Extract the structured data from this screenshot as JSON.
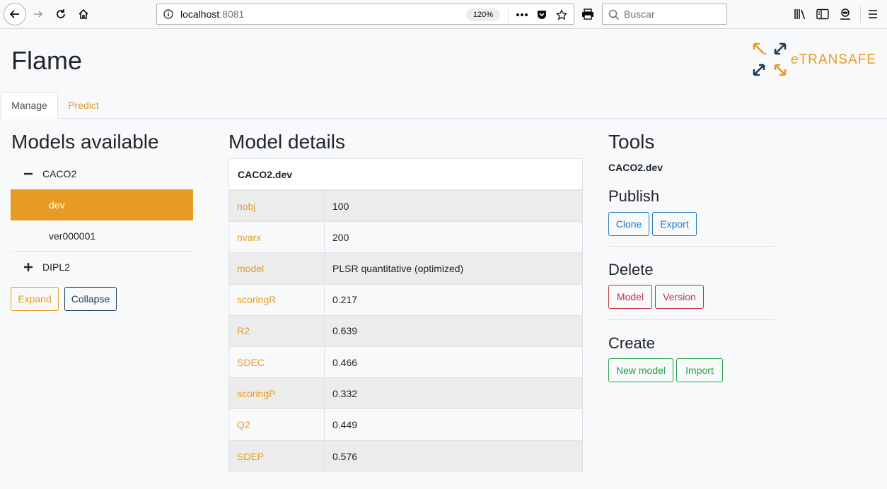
{
  "browser": {
    "url_host": "localhost",
    "url_port": ":8081",
    "zoom": "120%",
    "search_placeholder": "Buscar"
  },
  "app": {
    "title": "Flame",
    "logo_e": "e",
    "logo_text": "TRANSAFE"
  },
  "tabs": [
    {
      "label": "Manage",
      "active": true
    },
    {
      "label": "Predict",
      "active": false
    }
  ],
  "models_panel": {
    "heading": "Models available",
    "tree": [
      {
        "label": "CACO2",
        "expanded": true,
        "children": [
          {
            "label": "dev",
            "selected": true
          },
          {
            "label": "ver000001",
            "selected": false
          }
        ]
      },
      {
        "label": "DIPL2",
        "expanded": false
      }
    ],
    "expand_label": "Expand",
    "collapse_label": "Collapse"
  },
  "details_panel": {
    "heading": "Model details",
    "model_name": "CACO2.dev",
    "rows": [
      {
        "key": "nobj",
        "value": "100"
      },
      {
        "key": "nvarx",
        "value": "200"
      },
      {
        "key": "model",
        "value": "PLSR quantitative (optimized)"
      },
      {
        "key": "scoringR",
        "value": "0.217"
      },
      {
        "key": "R2",
        "value": "0.639"
      },
      {
        "key": "SDEC",
        "value": "0.466"
      },
      {
        "key": "scoringP",
        "value": "0.332"
      },
      {
        "key": "Q2",
        "value": "0.449"
      },
      {
        "key": "SDEP",
        "value": "0.576"
      }
    ]
  },
  "tools_panel": {
    "heading": "Tools",
    "model_name": "CACO2.dev",
    "publish": {
      "heading": "Publish",
      "clone_label": "Clone",
      "export_label": "Export"
    },
    "delete": {
      "heading": "Delete",
      "model_label": "Model",
      "version_label": "Version"
    },
    "create": {
      "heading": "Create",
      "new_model_label": "New model",
      "import_label": "Import"
    }
  },
  "colors": {
    "accent": "#e69c24",
    "navy": "#1a3d5c",
    "publish": "#2178c4",
    "delete": "#c0303f",
    "create": "#28a045"
  }
}
